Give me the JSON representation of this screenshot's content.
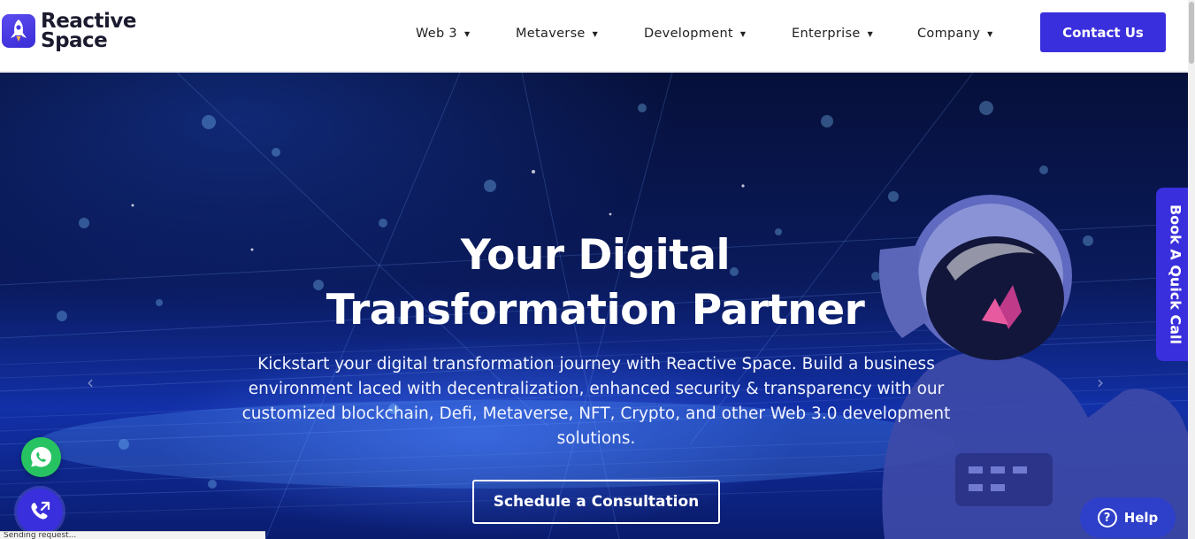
{
  "brand": {
    "line1": "Reactive",
    "line2": "Space",
    "logo_icon": "rocket-icon",
    "accent": "#3a2fdc"
  },
  "nav": {
    "items": [
      {
        "label": "Web 3"
      },
      {
        "label": "Metaverse"
      },
      {
        "label": "Development"
      },
      {
        "label": "Enterprise"
      },
      {
        "label": "Company"
      }
    ],
    "contact_label": "Contact Us"
  },
  "hero": {
    "title_line1": "Your Digital",
    "title_line2": "Transformation Partner",
    "subtitle": "Kickstart your digital transformation journey with Reactive Space. Build a business environment laced with decentralization, enhanced security & transparency with our customized blockchain, Defi, Metaverse, NFT, Crypto, and other Web 3.0 development solutions.",
    "cta_label": "Schedule a Consultation",
    "background_icon": "astronaut-illustration"
  },
  "side_tab": {
    "label": "Book A Quick Call"
  },
  "floating": {
    "whatsapp_icon": "whatsapp-icon",
    "phone_icon": "phone-icon",
    "help_label": "Help"
  },
  "status_bar": {
    "text": "Sending request..."
  }
}
